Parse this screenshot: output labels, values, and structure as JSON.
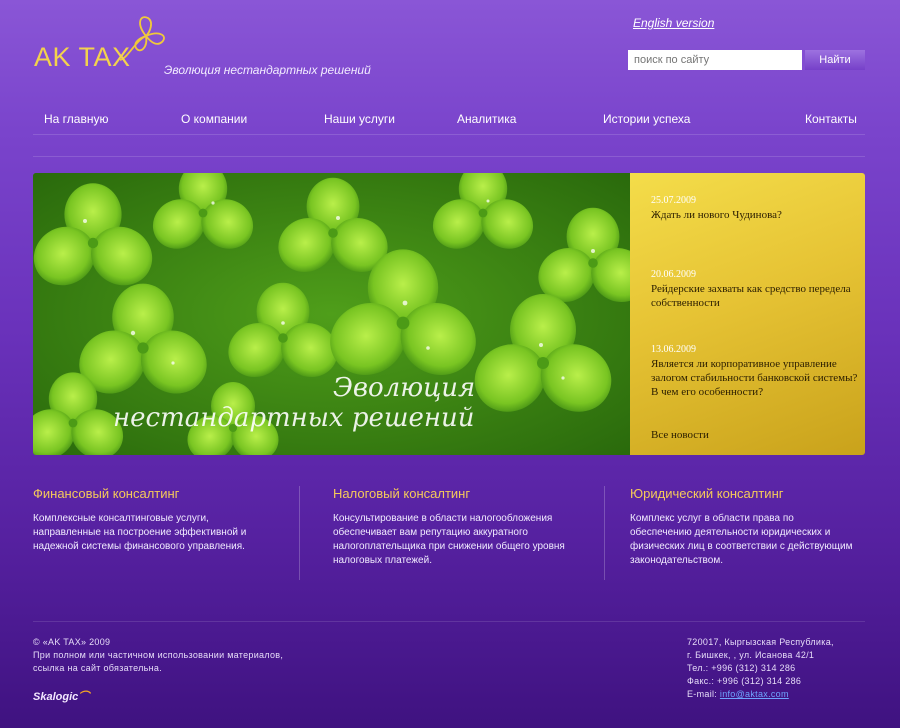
{
  "header": {
    "logo_text": "AK TAX",
    "tagline": "Эволюция нестандартных решений",
    "english_link": "English version",
    "search": {
      "placeholder": "поиск по сайту",
      "button_label": "Найти"
    }
  },
  "nav": {
    "items": [
      {
        "label": "На главную"
      },
      {
        "label": "О компании"
      },
      {
        "label": "Наши услуги"
      },
      {
        "label": "Аналитика"
      },
      {
        "label": "Истории успеха"
      },
      {
        "label": "Контакты"
      }
    ]
  },
  "banner": {
    "caption_line1": "Эволюция",
    "caption_line2": "нестандартных решений",
    "news": [
      {
        "date": "25.07.2009",
        "title": "Ждать ли нового Чудинова?"
      },
      {
        "date": "20.06.2009",
        "title": "Рейдерские захваты как средство передела собственности"
      },
      {
        "date": "13.06.2009",
        "title": "Является ли корпоративное управление залогом стабильности банковской системы? В чем его особенности?"
      }
    ],
    "all_news": "Все новости"
  },
  "columns": [
    {
      "title": "Финансовый консалтинг",
      "text": "Комплексные консалтинговые услуги, направленные на построение эффективной и надежной системы финансового управления."
    },
    {
      "title": "Налоговый консалтинг",
      "text": "Консультирование в области налогообложения обеспечивает вам репутацию аккуратного налогоплательщика при снижении общего уровня налоговых платежей."
    },
    {
      "title": "Юридический консалтинг",
      "text": "Комплекс услуг в области права по обеспечению деятельности юридических и физических лиц в соответствии с действующим законодательством."
    }
  ],
  "footer": {
    "copyright": "© «AK TAX» 2009",
    "notice_line1": "При полном или частичном использовании материалов,",
    "notice_line2": "ссылка на сайт обязательна.",
    "studio": "Skalogic",
    "address_line1": "720017, Кыргызская Республика,",
    "address_line2": "г. Бишкек, , ул. Исанова 42/1",
    "phone": "Тел.: +996 (312) 314 286",
    "fax": "Факс.: +996 (312) 314 286",
    "email_label": "E-mail: ",
    "email": "info@aktax.com"
  },
  "colors": {
    "accent_gold": "#f3d24d",
    "column_title": "#f5c95a",
    "news_panel": "#e6c334",
    "background": "#6a32bb"
  }
}
